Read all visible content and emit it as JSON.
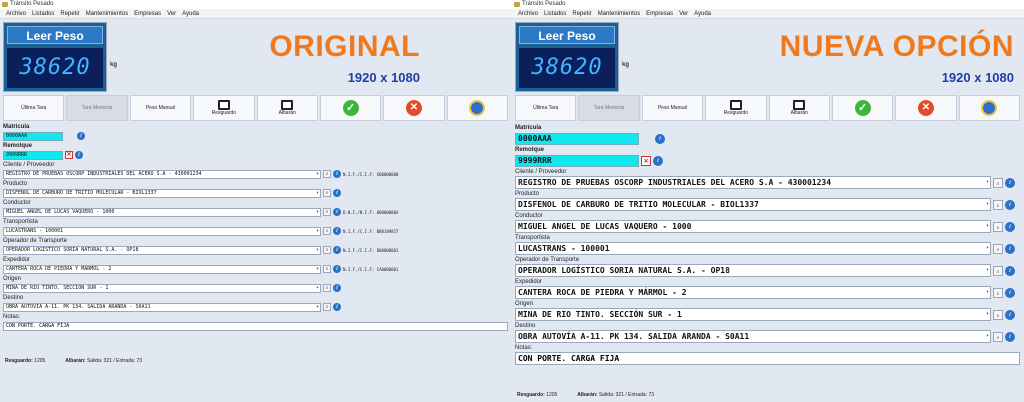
{
  "window": {
    "title": "Tránsito Pesado"
  },
  "menu": [
    "Archivo",
    "Listados",
    "Repetir",
    "Mantenimientos",
    "Empresas",
    "Ver",
    "Ayuda"
  ],
  "scale": {
    "button_label": "Leer Peso",
    "reading": "38620",
    "unit": "kg"
  },
  "toolbar": {
    "ultima_tara": "Última Tara",
    "tara_memoria": "Tara Memoria",
    "peso_manual": "Peso Manual",
    "resguardo": "Resguardo",
    "albaran": "Albarán"
  },
  "form": {
    "matricula_label": "Matrícula",
    "matricula_value": "0000AAA",
    "remolque_label": "Remolque",
    "remolque_value": "9999RRR",
    "cliente_label": "Cliente / Proveedor",
    "cliente_value": "REGISTRO DE PRUEBAS OSCORP INDUSTRIALES DEL ACERO S.A - 430001234",
    "cliente_id": "N.I.F./C.I.F: X00000000",
    "producto_label": "Producto",
    "producto_value": "DISFENOL DE CARBURO DE TRITIO MOLECULAR - BIOL1337",
    "conductor_label": "Conductor",
    "conductor_value": "MIGUEL ANGEL DE LUCAS VAQUERO - 1000",
    "conductor_id": "D.N.I./N.I.F: 00000000X",
    "transportista_label": "Transportista",
    "transportista_value": "LUCASTRANS - 100001",
    "transportista_id": "N.I.F./C.I.F: B88189857",
    "operador_label": "Operador de Transporte",
    "operador_value": "OPERADOR LOGÍSTICO SORIA NATURAL S.A. - OP18",
    "operador_id": "N.I.F./C.I.F: D00000001",
    "expedidor_label": "Expedidor",
    "expedidor_value": "CANTERA ROCA DE PIEDRA Y MÁRMOL - 2",
    "expedidor_id": "N.I.F./C.I.F: CA0000001",
    "origen_label": "Origen",
    "origen_value": "MINA DE RIO TINTO. SECCIÓN SUR - 1",
    "destino_label": "Destino",
    "destino_value": "OBRA AUTOVÍA A-11. PK 134. SALIDA ARANDA - S0A11",
    "notas_label": "Notas:",
    "notas_value": "CON PORTE. CARGA FIJA"
  },
  "footer": {
    "resguardo_label": "Resguardo:",
    "resguardo_value": "1205",
    "albaran_label": "Albarán:",
    "albaran_value": "Salida: 321 / Entrada: 73"
  },
  "left_panel": {
    "headline": "ORIGINAL",
    "resolution": "1920 x 1080"
  },
  "right_panel": {
    "headline": "NUEVA OPCIÓN",
    "resolution": "1920 x 1080"
  },
  "colors": {
    "headline": "#f07a1b",
    "resolution": "#1f3fa6",
    "plate": "#10e8f0",
    "display_bg": "#0b1f5a"
  },
  "icons": [
    "ok-icon",
    "cancel-icon",
    "globe-icon",
    "printer-icon",
    "search-icon",
    "info-icon",
    "delete-icon",
    "chevron-down-icon"
  ]
}
